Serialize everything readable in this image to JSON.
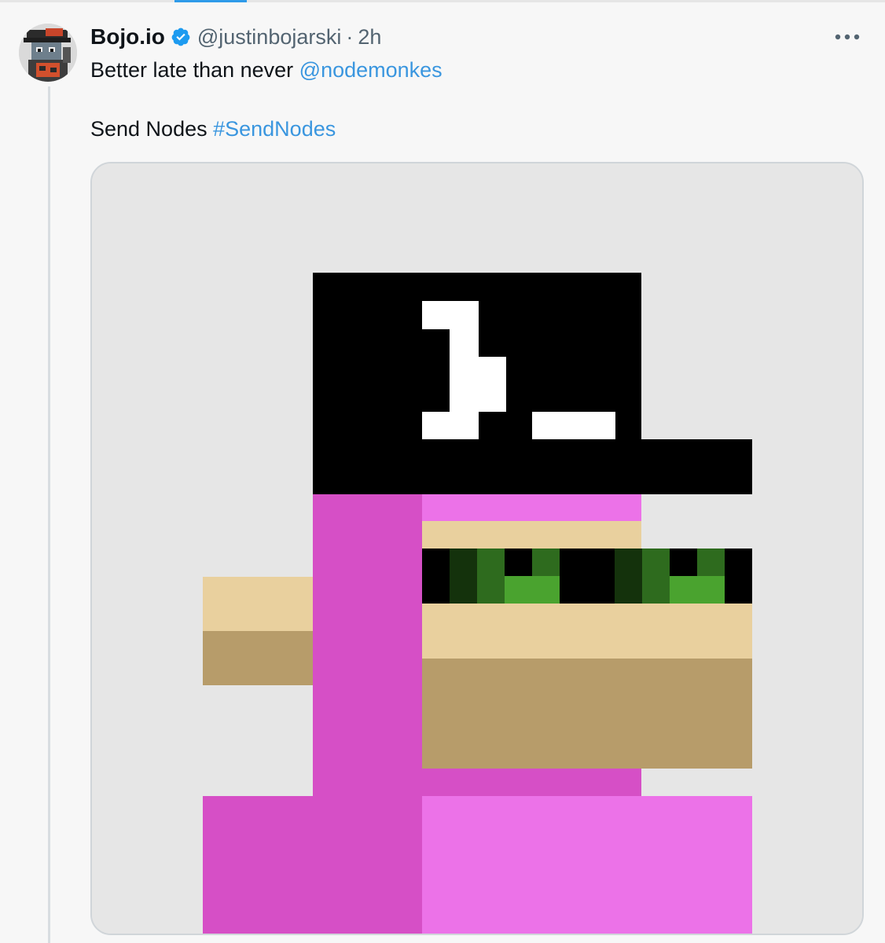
{
  "tweet": {
    "author_name": "Bojo.io",
    "verified": true,
    "handle": "@justinbojarski",
    "separator": "·",
    "timestamp": "2h",
    "text_line1_prefix": "Better late than never ",
    "mention": "@nodemonkes",
    "text_line2_prefix": "Send Nodes ",
    "hashtag": "#SendNodes"
  },
  "icons": {
    "verified": "verified-badge-icon",
    "more": "more-options-icon",
    "avatar": "user-avatar"
  },
  "colors": {
    "link": "#3a96df",
    "verified_badge": "#1d9bf0",
    "secondary_text": "#536471",
    "nft_background": "#e6e6e6",
    "nft_pink_dark": "#d64fc6",
    "nft_pink_light": "#ec72e8",
    "nft_tan_light": "#e9d09e",
    "nft_tan_dark": "#b79c6a",
    "nft_green": "#4aa32f"
  }
}
